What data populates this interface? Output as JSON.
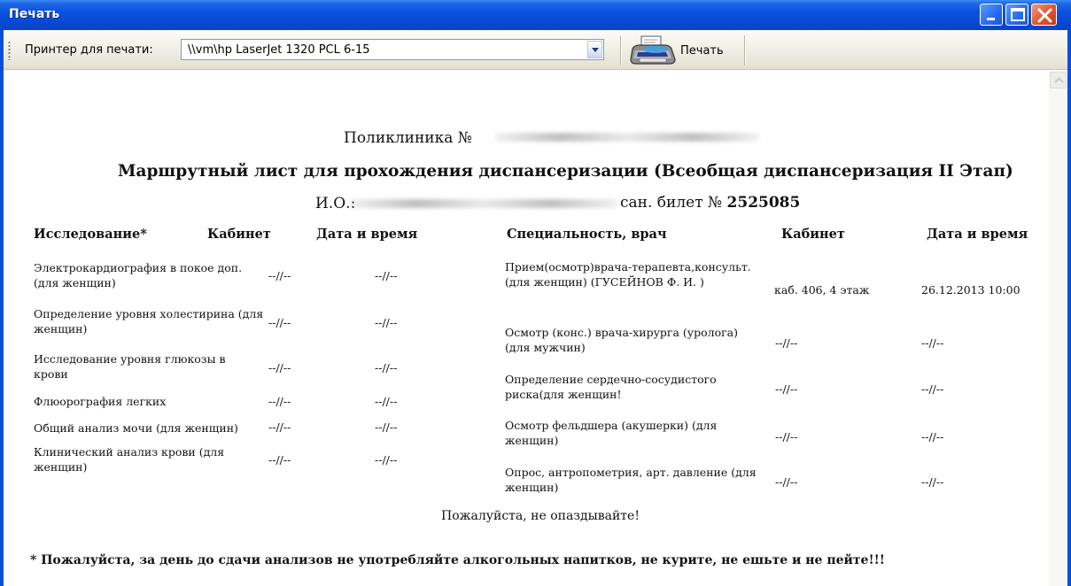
{
  "window": {
    "title": "Печать",
    "controls": [
      "minimize",
      "maximize",
      "close"
    ]
  },
  "toolbar": {
    "printer_label": "Принтер для печати:",
    "printer_value": "\\\\vm\\hp LaserJet 1320 PCL 6-15",
    "print_button_label": "Печать"
  },
  "document": {
    "clinic_prefix": "Поликлиника №",
    "title": "Маршрутный лист для прохождения диспансеризации (Всеобщая диспансеризация II Этап)",
    "patient_prefix": "И.О.:",
    "ticket_prefix": "сан. билет №",
    "ticket_number": "2525085",
    "left_table": {
      "headers": [
        "Исследование*",
        "Кабинет",
        "Дата и время"
      ],
      "rows": [
        {
          "name": "Электрокардиография в покое доп. (для женщин)",
          "room": "--//--",
          "datetime": "--//--"
        },
        {
          "name": "Определение уровня холестирина (для женщин)",
          "room": "--//--",
          "datetime": "--//--"
        },
        {
          "name": "Исследование уровня глюкозы в крови",
          "room": "--//--",
          "datetime": "--//--"
        },
        {
          "name": "Флюорография легких",
          "room": "--//--",
          "datetime": "--//--"
        },
        {
          "name": "Общий анализ мочи (для женщин)",
          "room": "--//--",
          "datetime": "--//--"
        },
        {
          "name": "Клинический анализ крови (для женщин)",
          "room": "--//--",
          "datetime": "--//--"
        }
      ]
    },
    "right_table": {
      "headers": [
        "Специальность, врач",
        "Кабинет",
        "Дата и время"
      ],
      "rows": [
        {
          "name": "Прием(осмотр)врача-терапевта,консульт.(для женщин) (ГУСЕЙНОВ Ф. И. )",
          "room": "каб. 406, 4 этаж",
          "datetime": "26.12.2013 10:00"
        },
        {
          "name": "Осмотр (конс.) врача-хирурга (уролога) (для мужчин)",
          "room": "--//--",
          "datetime": "--//--"
        },
        {
          "name": "Определение сердечно-сосудистого риска(для женщин!",
          "room": "--//--",
          "datetime": "--//--"
        },
        {
          "name": "Осмотр фельдшера (акушерки) (для женщин)",
          "room": "--//--",
          "datetime": "--//--"
        },
        {
          "name": "Опрос, антропометрия, арт. давление (для женщин)",
          "room": "--//--",
          "datetime": "--//--"
        }
      ]
    },
    "reminder": "Пожалуйста, не опаздывайте!",
    "footnote": "* Пожалуйста, за день до сдачи анализов не употребляйте алкогольных напитков, не курите, не ешьте и не пейте!!!"
  }
}
